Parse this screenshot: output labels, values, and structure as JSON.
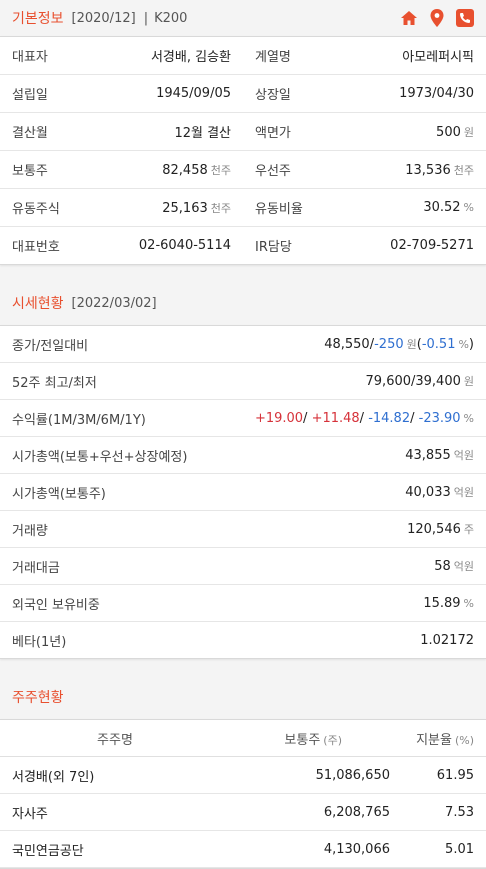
{
  "basic": {
    "title": "기본정보",
    "date": "[2020/12]",
    "divider": "|",
    "index": "K200",
    "rows": [
      {
        "l1": "대표자",
        "v1": "서경배, 김승환",
        "u1": "",
        "l2": "계열명",
        "v2": "아모레퍼시픽",
        "u2": ""
      },
      {
        "l1": "설립일",
        "v1": "1945/09/05",
        "u1": "",
        "l2": "상장일",
        "v2": "1973/04/30",
        "u2": ""
      },
      {
        "l1": "결산월",
        "v1": "12월 결산",
        "u1": "",
        "l2": "액면가",
        "v2": "500",
        "u2": "원"
      },
      {
        "l1": "보통주",
        "v1": "82,458",
        "u1": "천주",
        "l2": "우선주",
        "v2": "13,536",
        "u2": "천주"
      },
      {
        "l1": "유동주식",
        "v1": "25,163",
        "u1": "천주",
        "l2": "유동비율",
        "v2": "30.52",
        "u2": "%"
      },
      {
        "l1": "대표번호",
        "v1": "02-6040-5114",
        "u1": "",
        "l2": "IR담당",
        "v2": "02-709-5271",
        "u2": ""
      }
    ]
  },
  "market": {
    "title": "시세현황",
    "date": "[2022/03/02]",
    "price_label": "종가/전일대비",
    "price": "48,550",
    "price_sep": "/",
    "change": "-250",
    "change_unit": "원",
    "pct_open": "(",
    "pct": "-0.51",
    "pct_unit": "%",
    "pct_close": ")",
    "week52_label": "52주 최고/최저",
    "week52": "79,600/39,400",
    "week52_unit": "원",
    "returns_label": "수익률(1M/3M/6M/1Y)",
    "r1": "+19.00",
    "r2": "+11.48",
    "r3": "-14.82",
    "r4": "-23.90",
    "sep": "/ ",
    "returns_unit": "%",
    "rows": [
      {
        "label": "시가총액(보통+우선+상장예정)",
        "value": "43,855",
        "unit": "억원"
      },
      {
        "label": "시가총액(보통주)",
        "value": "40,033",
        "unit": "억원"
      },
      {
        "label": "거래량",
        "value": "120,546",
        "unit": "주"
      },
      {
        "label": "거래대금",
        "value": "58",
        "unit": "억원"
      },
      {
        "label": "외국인 보유비중",
        "value": "15.89",
        "unit": "%"
      },
      {
        "label": "베타(1년)",
        "value": "1.02172",
        "unit": ""
      }
    ]
  },
  "holders": {
    "title": "주주현황",
    "col_name": "주주명",
    "col_shares": "보통주",
    "col_shares_unit": "(주)",
    "col_ratio": "지분율",
    "col_ratio_unit": "(%)",
    "rows": [
      {
        "name": "서경배(외 7인)",
        "shares": "51,086,650",
        "ratio": "61.95"
      },
      {
        "name": "자사주",
        "shares": "6,208,765",
        "ratio": "7.53"
      },
      {
        "name": "국민연금공단",
        "shares": "4,130,066",
        "ratio": "5.01"
      }
    ]
  },
  "colors": {
    "accent": "#e8502f",
    "up": "#d6323a",
    "down": "#2f6fd0"
  },
  "icons": [
    "home-icon",
    "location-pin-icon",
    "phone-icon"
  ]
}
